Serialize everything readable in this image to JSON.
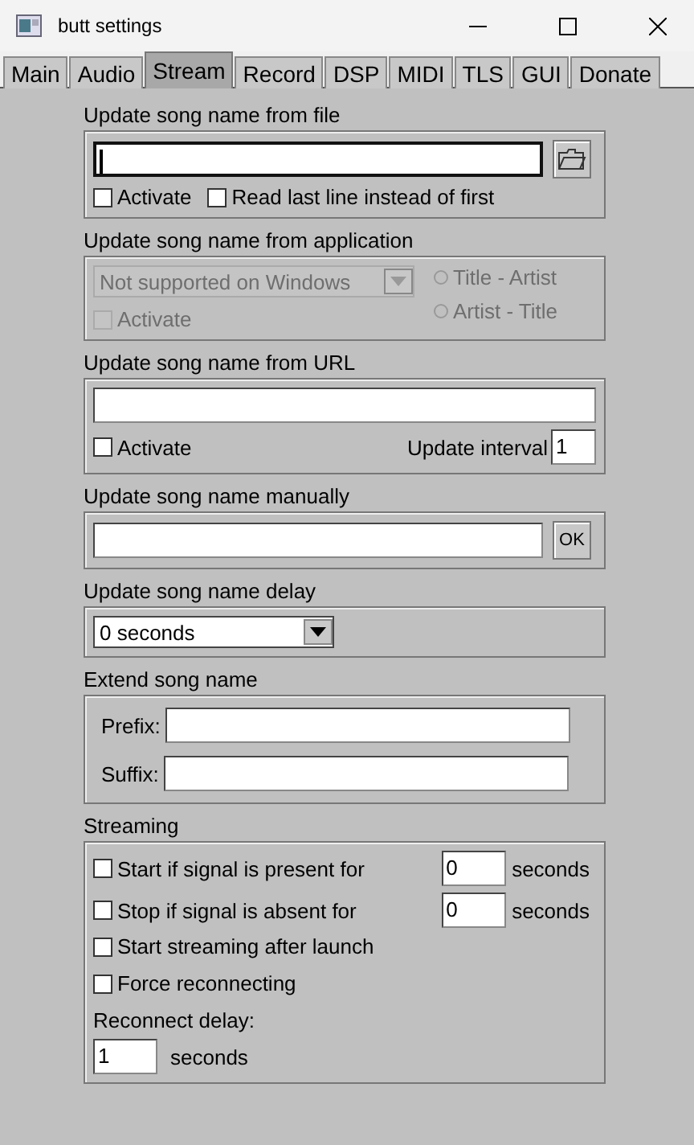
{
  "window": {
    "title": "butt settings"
  },
  "tabs": [
    {
      "label": "Main",
      "selected": false
    },
    {
      "label": "Audio",
      "selected": false
    },
    {
      "label": "Stream",
      "selected": true
    },
    {
      "label": "Record",
      "selected": false
    },
    {
      "label": "DSP",
      "selected": false
    },
    {
      "label": "MIDI",
      "selected": false
    },
    {
      "label": "TLS",
      "selected": false
    },
    {
      "label": "GUI",
      "selected": false
    },
    {
      "label": "Donate",
      "selected": false
    }
  ],
  "sections": [
    {
      "kind": "file",
      "title": "Update song name from file",
      "field": {
        "focused": true
      },
      "checks": [
        {
          "label": "Activate",
          "checked": false
        },
        {
          "label": "Read last line instead of first",
          "checked": false
        }
      ]
    },
    {
      "kind": "application",
      "title": "Update song name from application",
      "disabled": true,
      "dropdown": {
        "value": "Not supported on Windows"
      },
      "check": {
        "label": "Activate",
        "checked": false
      },
      "radios": [
        {
          "label": "Title - Artist",
          "selected": false
        },
        {
          "label": "Artist - Title",
          "selected": false
        }
      ]
    },
    {
      "kind": "url",
      "title": "Update song name from URL",
      "field": {
        "focused": false
      },
      "check": {
        "label": "Activate",
        "checked": false
      },
      "interval": {
        "label": "Update interval",
        "value": "1"
      }
    },
    {
      "kind": "manual",
      "title": "Update song name manually",
      "field": {
        "focused": false
      },
      "button": "OK"
    },
    {
      "kind": "delay",
      "title": "Update song name delay",
      "dropdown": {
        "value": "0 seconds"
      }
    },
    {
      "kind": "extend",
      "title": "Extend song name",
      "rows": [
        {
          "label": "Prefix:"
        },
        {
          "label": "Suffix:"
        }
      ]
    },
    {
      "kind": "streaming",
      "title": "Streaming",
      "rows": [
        {
          "label": "Start if signal is present for",
          "checked": false,
          "value": "0",
          "unit": "seconds"
        },
        {
          "label": "Stop if signal is absent for",
          "checked": false,
          "value": "0",
          "unit": "seconds"
        }
      ],
      "checks": [
        {
          "label": "Start streaming after launch",
          "checked": false
        },
        {
          "label": "Force reconnecting",
          "checked": false
        }
      ],
      "reconnect": {
        "label": "Reconnect delay:",
        "value": "1",
        "unit": "seconds"
      }
    }
  ]
}
